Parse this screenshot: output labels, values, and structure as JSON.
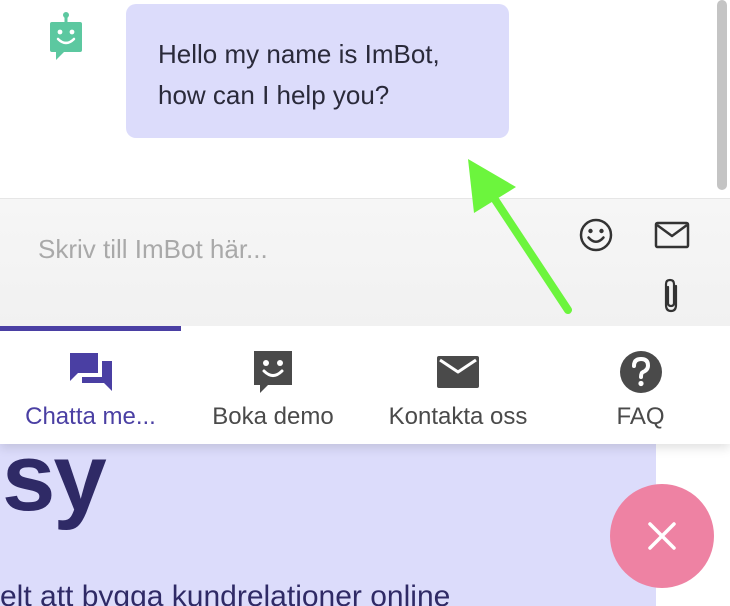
{
  "chat": {
    "bot_message_lines": [
      "Hello my name is ImBot,",
      "how can I help you?"
    ],
    "input_placeholder": "Skriv till ImBot här...",
    "icons": {
      "avatar": "robot-icon",
      "emoji": "smiley-icon",
      "mail": "envelope-icon",
      "attach": "paperclip-icon"
    }
  },
  "tabs": [
    {
      "label": "Chatta me...",
      "icon": "chat-bubbles-icon",
      "active": true
    },
    {
      "label": "Boka demo",
      "icon": "smiley-bubble-icon",
      "active": false
    },
    {
      "label": "Kontakta oss",
      "icon": "envelope-icon",
      "active": false
    },
    {
      "label": "FAQ",
      "icon": "question-circle-icon",
      "active": false
    }
  ],
  "background": {
    "hero_big": "sy",
    "hero_sub": "elt att bygga kundrelationer online"
  },
  "colors": {
    "accent": "#4a3fa3",
    "bubble": "#dcdcfb",
    "bot_green": "#5cc8a0",
    "close_fab": "#ee82a3",
    "arrow": "#6cf53d"
  }
}
